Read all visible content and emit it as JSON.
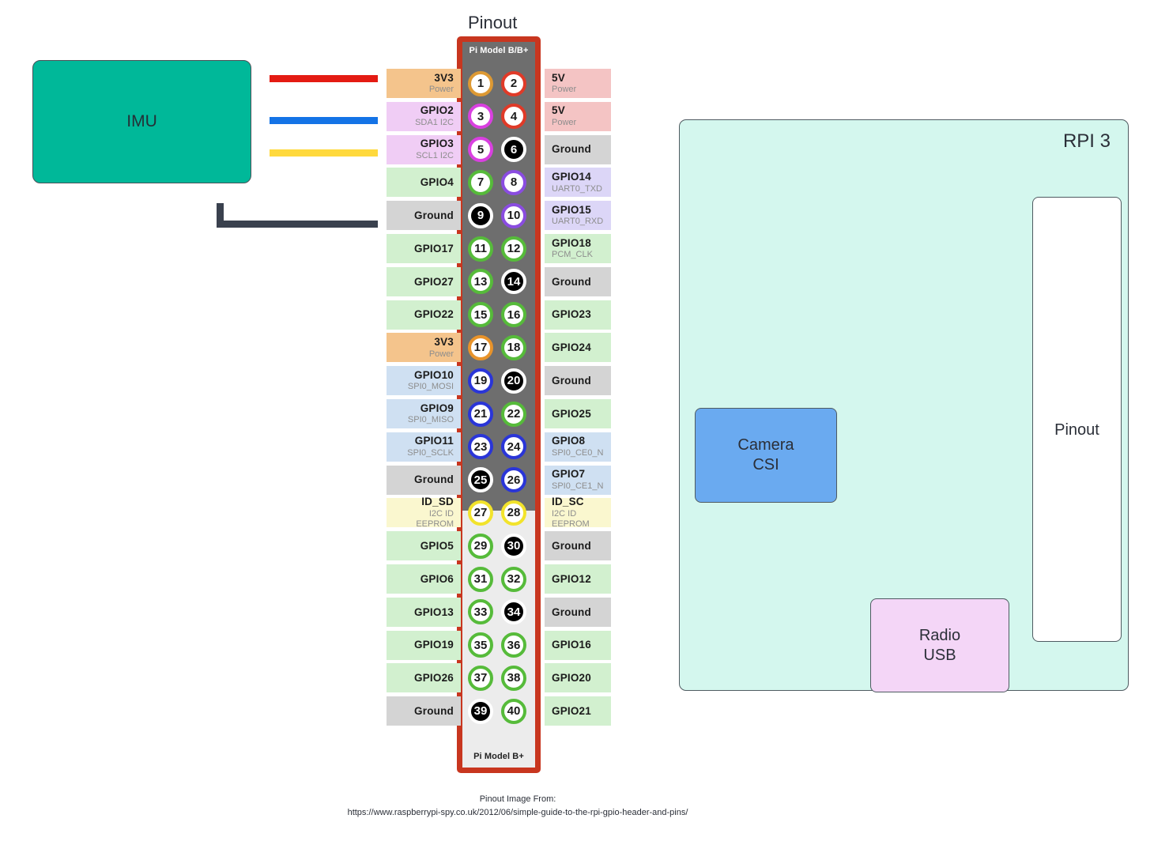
{
  "title": "Pinout",
  "imu": {
    "label": "IMU",
    "color": "#00b899"
  },
  "rpi": {
    "label": "RPI 3",
    "color": "#d4f7ee"
  },
  "camera": {
    "label": "Camera\nCSI",
    "color": "#6aaaf0"
  },
  "radio": {
    "label": "Radio\nUSB",
    "color": "#f4d6f7"
  },
  "pinout_panel": {
    "label": "Pinout",
    "color": "#ffffff"
  },
  "wires": [
    {
      "name": "power-wire",
      "color": "#e41b13",
      "connects_to_pin": 1
    },
    {
      "name": "sda-wire",
      "color": "#1473e6",
      "connects_to_pin": 3
    },
    {
      "name": "scl-wire",
      "color": "#ffd93d",
      "connects_to_pin": 5
    },
    {
      "name": "ground-wire",
      "color": "#3a414e",
      "connects_to_pin": 9
    }
  ],
  "header": {
    "top_label": "Pi Model B/B+",
    "bottom_label": "Pi Model B+",
    "frame_color": "#c8361f"
  },
  "caption": {
    "line1": "Pinout Image From:",
    "line2": "https://www.raspberrypi-spy.co.uk/2012/06/simple-guide-to-the-rpi-gpio-header-and-pins/"
  },
  "chart_data": {
    "type": "table",
    "title": "Raspberry Pi Model B/B+ 40-pin GPIO header pinout",
    "columns": [
      "left_name",
      "left_function",
      "pin_odd",
      "pin_even",
      "right_name",
      "right_function"
    ],
    "rows": [
      {
        "left_name": "3V3",
        "left_function": "Power",
        "odd": 1,
        "odd_ring": "#dd9933",
        "odd_fill": "white",
        "even": 2,
        "even_ring": "#e03a28",
        "even_fill": "white",
        "right_name": "5V",
        "right_function": "Power",
        "left_class": "c-power3",
        "right_class": "c-power5"
      },
      {
        "left_name": "GPIO2",
        "left_function": "SDA1 I2C",
        "odd": 3,
        "odd_ring": "#d940e0",
        "odd_fill": "white",
        "even": 4,
        "even_ring": "#e03a28",
        "even_fill": "white",
        "right_name": "5V",
        "right_function": "Power",
        "left_class": "c-i2c",
        "right_class": "c-power5"
      },
      {
        "left_name": "GPIO3",
        "left_function": "SCL1 I2C",
        "odd": 5,
        "odd_ring": "#d940e0",
        "odd_fill": "white",
        "even": 6,
        "even_ring": "#ffffff",
        "even_fill": "black",
        "right_name": "Ground",
        "right_function": "",
        "left_class": "c-i2c",
        "right_class": "c-gnd"
      },
      {
        "left_name": "GPIO4",
        "left_function": "",
        "odd": 7,
        "odd_ring": "#56bb3a",
        "odd_fill": "white",
        "even": 8,
        "even_ring": "#8a4ce0",
        "even_fill": "white",
        "right_name": "GPIO14",
        "right_function": "UART0_TXD",
        "left_class": "c-gpio",
        "right_class": "c-uart"
      },
      {
        "left_name": "Ground",
        "left_function": "",
        "odd": 9,
        "odd_ring": "#ffffff",
        "odd_fill": "black",
        "even": 10,
        "even_ring": "#8a4ce0",
        "even_fill": "white",
        "right_name": "GPIO15",
        "right_function": "UART0_RXD",
        "left_class": "c-gnd",
        "right_class": "c-uart"
      },
      {
        "left_name": "GPIO17",
        "left_function": "",
        "odd": 11,
        "odd_ring": "#56bb3a",
        "odd_fill": "white",
        "even": 12,
        "even_ring": "#56bb3a",
        "even_fill": "white",
        "right_name": "GPIO18",
        "right_function": "PCM_CLK",
        "left_class": "c-gpio",
        "right_class": "c-pcm"
      },
      {
        "left_name": "GPIO27",
        "left_function": "",
        "odd": 13,
        "odd_ring": "#56bb3a",
        "odd_fill": "white",
        "even": 14,
        "even_ring": "#ffffff",
        "even_fill": "black",
        "right_name": "Ground",
        "right_function": "",
        "left_class": "c-gpio",
        "right_class": "c-gnd"
      },
      {
        "left_name": "GPIO22",
        "left_function": "",
        "odd": 15,
        "odd_ring": "#56bb3a",
        "odd_fill": "white",
        "even": 16,
        "even_ring": "#56bb3a",
        "even_fill": "white",
        "right_name": "GPIO23",
        "right_function": "",
        "left_class": "c-gpio",
        "right_class": "c-gpio"
      },
      {
        "left_name": "3V3",
        "left_function": "Power",
        "odd": 17,
        "odd_ring": "#e8932a",
        "odd_fill": "white",
        "even": 18,
        "even_ring": "#56bb3a",
        "even_fill": "white",
        "right_name": "GPIO24",
        "right_function": "",
        "left_class": "c-power3",
        "right_class": "c-gpio"
      },
      {
        "left_name": "GPIO10",
        "left_function": "SPI0_MOSI",
        "odd": 19,
        "odd_ring": "#2a35d8",
        "odd_fill": "white",
        "even": 20,
        "even_ring": "#ffffff",
        "even_fill": "black",
        "right_name": "Ground",
        "right_function": "",
        "left_class": "c-spi",
        "right_class": "c-gnd"
      },
      {
        "left_name": "GPIO9",
        "left_function": "SPI0_MISO",
        "odd": 21,
        "odd_ring": "#2a35d8",
        "odd_fill": "white",
        "even": 22,
        "even_ring": "#56bb3a",
        "even_fill": "white",
        "right_name": "GPIO25",
        "right_function": "",
        "left_class": "c-spi",
        "right_class": "c-gpio"
      },
      {
        "left_name": "GPIO11",
        "left_function": "SPI0_SCLK",
        "odd": 23,
        "odd_ring": "#2a35d8",
        "odd_fill": "white",
        "even": 24,
        "even_ring": "#2a35d8",
        "even_fill": "white",
        "right_name": "GPIO8",
        "right_function": "SPI0_CE0_N",
        "left_class": "c-spi",
        "right_class": "c-spi"
      },
      {
        "left_name": "Ground",
        "left_function": "",
        "odd": 25,
        "odd_ring": "#ffffff",
        "odd_fill": "black",
        "even": 26,
        "even_ring": "#2a35d8",
        "even_fill": "white",
        "right_name": "GPIO7",
        "right_function": "SPI0_CE1_N",
        "left_class": "c-gnd",
        "right_class": "c-spi"
      },
      {
        "left_name": "ID_SD",
        "left_function": "I2C ID EEPROM",
        "odd": 27,
        "odd_ring": "#f2e32b",
        "odd_fill": "white",
        "even": 28,
        "even_ring": "#f2e32b",
        "even_fill": "white",
        "right_name": "ID_SC",
        "right_function": "I2C ID EEPROM",
        "left_class": "c-eeprom",
        "right_class": "c-eeprom"
      },
      {
        "left_name": "GPIO5",
        "left_function": "",
        "odd": 29,
        "odd_ring": "#56bb3a",
        "odd_fill": "white",
        "even": 30,
        "even_ring": "#ffffff",
        "even_fill": "black",
        "right_name": "Ground",
        "right_function": "",
        "left_class": "c-gpio",
        "right_class": "c-gnd"
      },
      {
        "left_name": "GPIO6",
        "left_function": "",
        "odd": 31,
        "odd_ring": "#56bb3a",
        "odd_fill": "white",
        "even": 32,
        "even_ring": "#56bb3a",
        "even_fill": "white",
        "right_name": "GPIO12",
        "right_function": "",
        "left_class": "c-gpio",
        "right_class": "c-gpio"
      },
      {
        "left_name": "GPIO13",
        "left_function": "",
        "odd": 33,
        "odd_ring": "#56bb3a",
        "odd_fill": "white",
        "even": 34,
        "even_ring": "#ffffff",
        "even_fill": "black",
        "right_name": "Ground",
        "right_function": "",
        "left_class": "c-gpio",
        "right_class": "c-gnd"
      },
      {
        "left_name": "GPIO19",
        "left_function": "",
        "odd": 35,
        "odd_ring": "#56bb3a",
        "odd_fill": "white",
        "even": 36,
        "even_ring": "#56bb3a",
        "even_fill": "white",
        "right_name": "GPIO16",
        "right_function": "",
        "left_class": "c-gpio",
        "right_class": "c-gpio"
      },
      {
        "left_name": "GPIO26",
        "left_function": "",
        "odd": 37,
        "odd_ring": "#56bb3a",
        "odd_fill": "white",
        "even": 38,
        "even_ring": "#56bb3a",
        "even_fill": "white",
        "right_name": "GPIO20",
        "right_function": "",
        "left_class": "c-gpio",
        "right_class": "c-gpio"
      },
      {
        "left_name": "Ground",
        "left_function": "",
        "odd": 39,
        "odd_ring": "#ffffff",
        "odd_fill": "black",
        "even": 40,
        "even_ring": "#56bb3a",
        "even_fill": "white",
        "right_name": "GPIO21",
        "right_function": "",
        "left_class": "c-gnd",
        "right_class": "c-gpio"
      }
    ]
  }
}
